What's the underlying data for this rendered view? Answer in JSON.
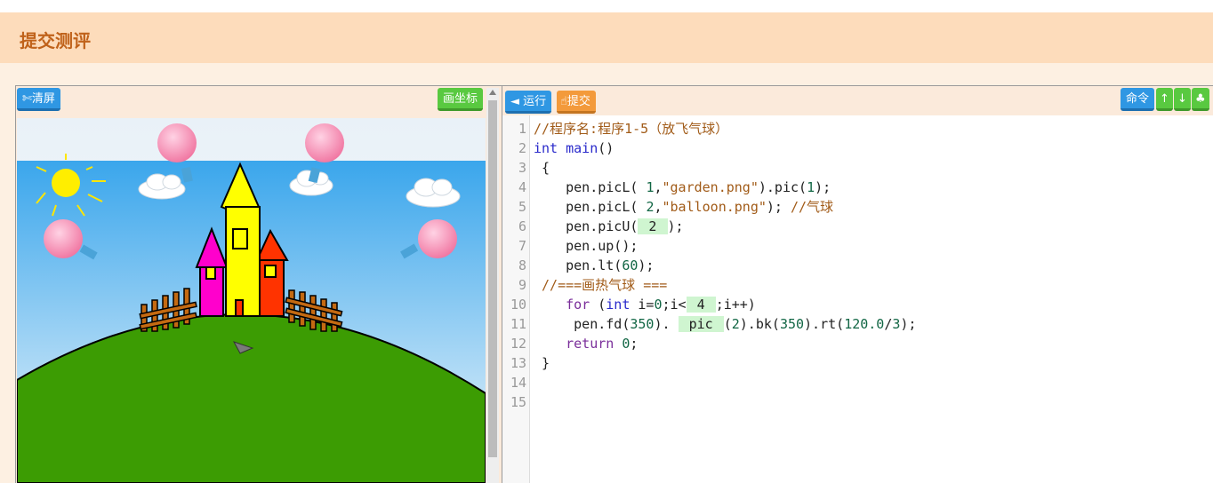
{
  "header": {
    "title": "提交测评"
  },
  "left_toolbar": {
    "clear_label": "✄清屏",
    "coord_label": "画坐标"
  },
  "right_toolbar": {
    "run_label": "◄ 运行",
    "submit_label": "提交",
    "command_label": "命令",
    "up_label": "↑",
    "down_label": "↓",
    "extra_label": "♣"
  },
  "colors": {
    "accent_blue": "#2f97e3",
    "accent_green": "#59c940",
    "accent_orange": "#f39a3b",
    "header_bg": "#fddcbb",
    "title_color": "#c0621a"
  },
  "editor": {
    "line_numbers": [
      "1",
      "2",
      "3",
      "4",
      "5",
      "6",
      "7",
      "8",
      "9",
      "10",
      "11",
      "12",
      "13",
      "14",
      "15"
    ],
    "lines": [
      {
        "parts": [
          {
            "t": "//程序名:程序1-5（放飞气球）",
            "c": "cmt"
          }
        ]
      },
      {
        "parts": [
          {
            "t": "int",
            "c": "kw"
          },
          {
            "t": " main",
            "c": "kw"
          },
          {
            "t": "()",
            "c": ""
          }
        ]
      },
      {
        "parts": [
          {
            "t": " {",
            "c": ""
          }
        ]
      },
      {
        "parts": [
          {
            "t": "    pen.picL( ",
            "c": ""
          },
          {
            "t": "1",
            "c": "num"
          },
          {
            "t": ",",
            "c": ""
          },
          {
            "t": "\"garden.png\"",
            "c": "str"
          },
          {
            "t": ").pic(",
            "c": ""
          },
          {
            "t": "1",
            "c": "num"
          },
          {
            "t": ");",
            "c": ""
          }
        ]
      },
      {
        "parts": [
          {
            "t": "    pen.picL( ",
            "c": ""
          },
          {
            "t": "2",
            "c": "num"
          },
          {
            "t": ",",
            "c": ""
          },
          {
            "t": "\"balloon.png\"",
            "c": "str"
          },
          {
            "t": "); ",
            "c": ""
          },
          {
            "t": "//气球",
            "c": "cmt"
          }
        ]
      },
      {
        "parts": [
          {
            "t": "    pen.picU(",
            "c": ""
          },
          {
            "t": " 2 ",
            "c": "hl"
          },
          {
            "t": ");",
            "c": ""
          }
        ]
      },
      {
        "parts": [
          {
            "t": "    pen.up();",
            "c": ""
          }
        ]
      },
      {
        "parts": [
          {
            "t": "    pen.lt(",
            "c": ""
          },
          {
            "t": "60",
            "c": "num"
          },
          {
            "t": ");",
            "c": ""
          }
        ]
      },
      {
        "parts": [
          {
            "t": " //===画热气球 ===",
            "c": "cmt"
          }
        ]
      },
      {
        "parts": [
          {
            "t": "    ",
            "c": ""
          },
          {
            "t": "for",
            "c": "kw2"
          },
          {
            "t": " (",
            "c": ""
          },
          {
            "t": "int",
            "c": "kw"
          },
          {
            "t": " i=",
            "c": ""
          },
          {
            "t": "0",
            "c": "num"
          },
          {
            "t": ";i<",
            "c": ""
          },
          {
            "t": " 4 ",
            "c": "hl"
          },
          {
            "t": ";i++)",
            "c": ""
          }
        ]
      },
      {
        "parts": [
          {
            "t": "     pen.fd(",
            "c": ""
          },
          {
            "t": "350",
            "c": "num"
          },
          {
            "t": "). ",
            "c": ""
          },
          {
            "t": " pic ",
            "c": "hl"
          },
          {
            "t": "(",
            "c": ""
          },
          {
            "t": "2",
            "c": "num"
          },
          {
            "t": ").bk(",
            "c": ""
          },
          {
            "t": "350",
            "c": "num"
          },
          {
            "t": ").rt(",
            "c": ""
          },
          {
            "t": "120.0",
            "c": "num"
          },
          {
            "t": "/",
            "c": ""
          },
          {
            "t": "3",
            "c": "num"
          },
          {
            "t": ");",
            "c": ""
          }
        ]
      },
      {
        "parts": [
          {
            "t": "    ",
            "c": ""
          },
          {
            "t": "return",
            "c": "kw2"
          },
          {
            "t": " ",
            "c": ""
          },
          {
            "t": "0",
            "c": "num"
          },
          {
            "t": ";",
            "c": ""
          }
        ]
      },
      {
        "parts": [
          {
            "t": " }",
            "c": ""
          }
        ]
      },
      {
        "parts": [
          {
            "t": "",
            "c": ""
          }
        ]
      },
      {
        "parts": [
          {
            "t": "",
            "c": ""
          }
        ]
      }
    ]
  }
}
